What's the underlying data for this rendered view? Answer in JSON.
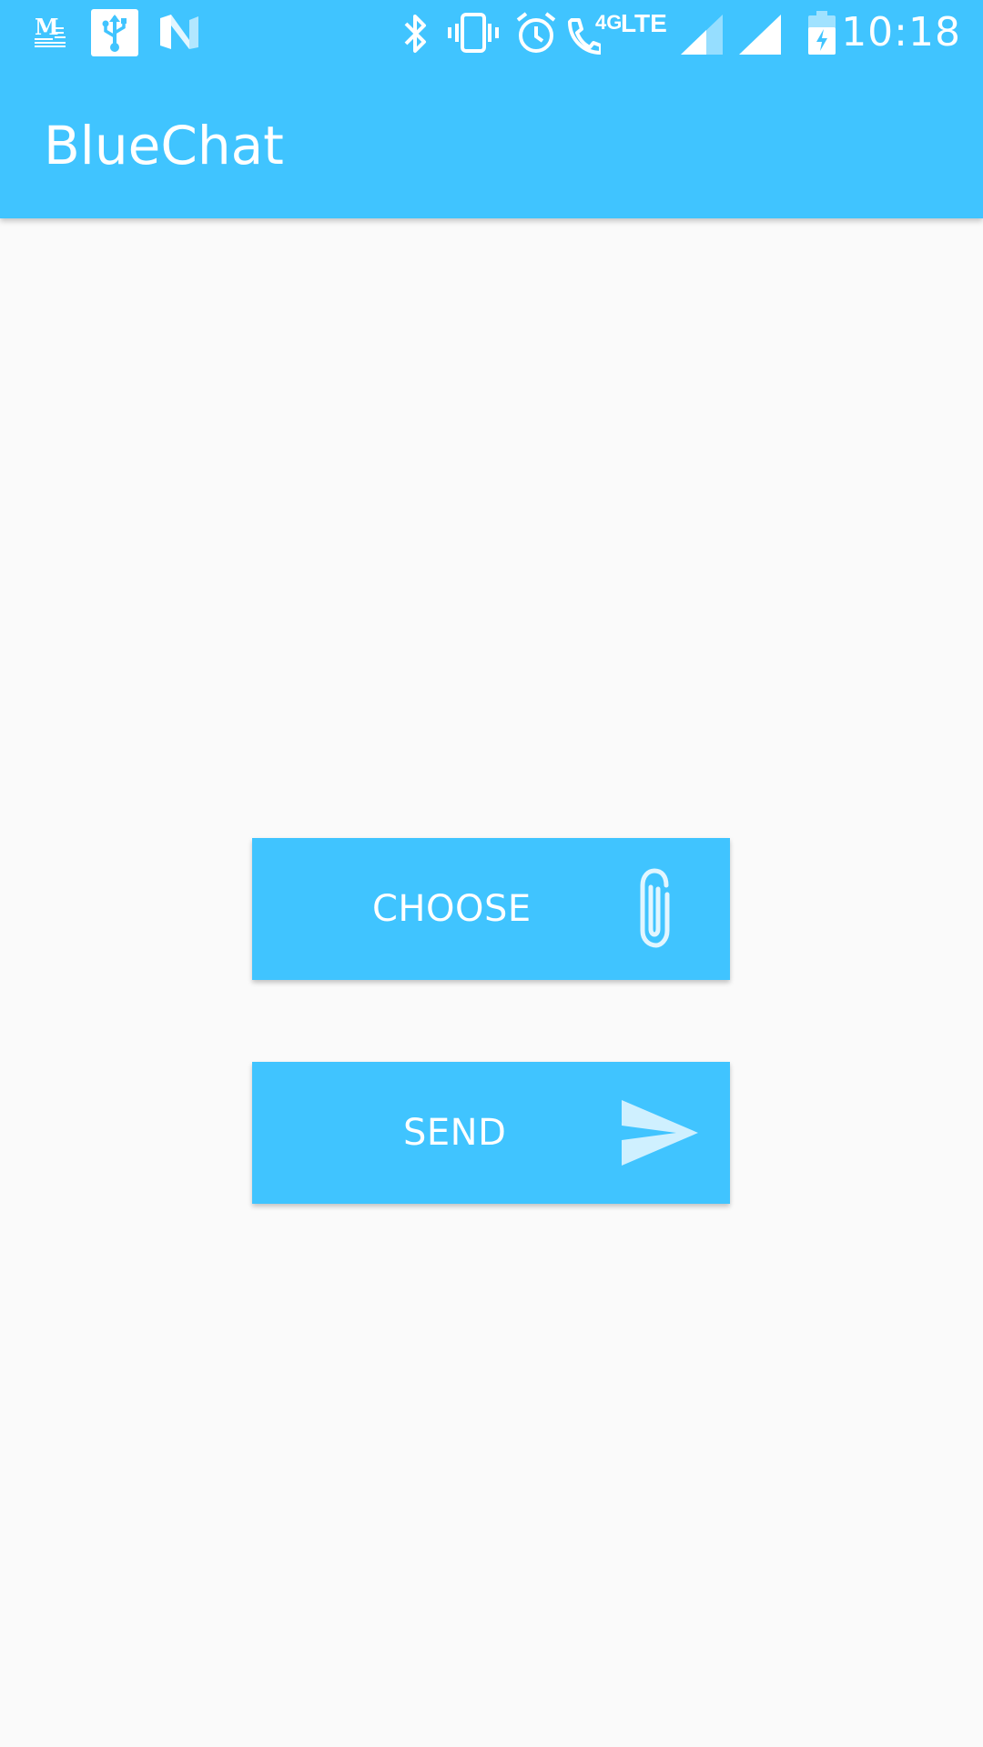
{
  "status_bar": {
    "time": "10:18",
    "network_4g": "4G",
    "network_lte": "LTE",
    "notification_icons": [
      "gmail-icon",
      "usb-icon",
      "nougat-icon"
    ],
    "system_icons": [
      "bluetooth-icon",
      "vibrate-icon",
      "alarm-icon",
      "wifi-calling-icon",
      "signal-icon",
      "signal-icon",
      "battery-charging-icon"
    ]
  },
  "app_bar": {
    "title": "BlueChat"
  },
  "actions": {
    "choose_label": "CHOOSE",
    "choose_icon": "paperclip-icon",
    "send_label": "SEND",
    "send_icon": "send-icon"
  },
  "colors": {
    "primary": "#40c4ff",
    "background": "#fafafa",
    "on_primary": "#ffffff"
  }
}
